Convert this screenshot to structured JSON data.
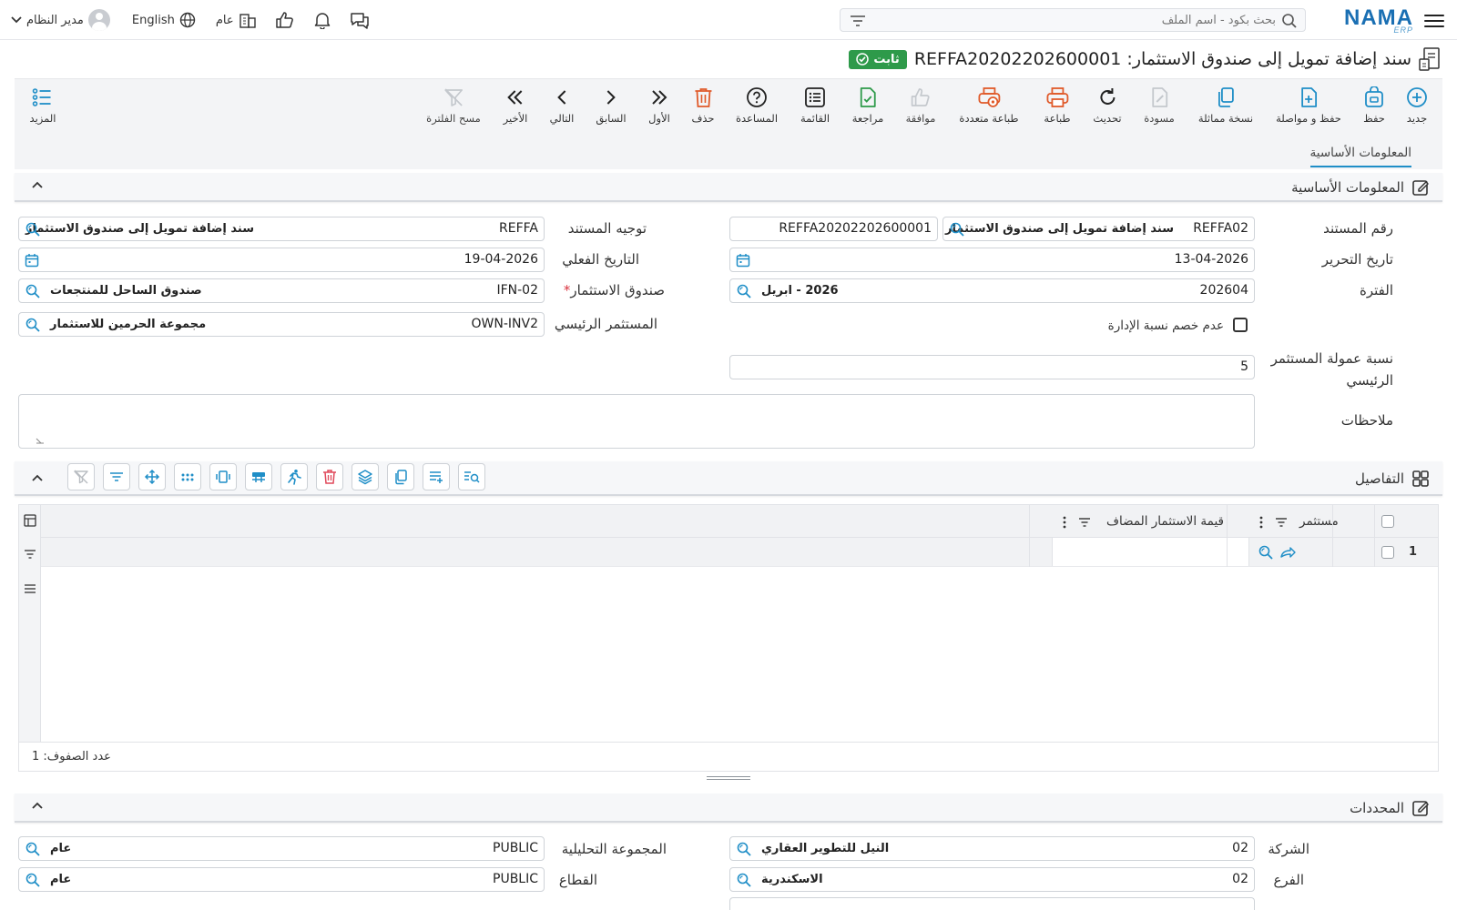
{
  "topbar": {
    "logo": "NAMA",
    "logo_sub": "ERP",
    "search_placeholder": "بحث بكود - اسم الملف",
    "user_name": "مدير النظام",
    "language": "English",
    "company_scope": "عام"
  },
  "title": {
    "text": "سند إضافة تمويل إلى صندوق الاستثمار: REFFA20202202600001",
    "status": "ثابت"
  },
  "toolbar": {
    "new": "جديد",
    "save": "حفظ",
    "save_continue": "حفظ و مواصلة",
    "duplicate": "نسخة مماثلة",
    "draft": "مسودة",
    "refresh": "تحديث",
    "print": "طباعة",
    "multi_print": "طباعة متعددة",
    "approve": "موافقة",
    "review": "مراجعة",
    "list": "القائمة",
    "help": "المساعدة",
    "delete": "حذف",
    "first": "الأول",
    "previous": "السابق",
    "next": "التالي",
    "last": "الأخير",
    "clear_filter": "مسح الفلترة",
    "more": "المزيد"
  },
  "tabs": {
    "basic_info": "المعلومات الأساسية"
  },
  "basic": {
    "section_title": "المعلومات الأساسية",
    "doc_number_label": "رقم المستند",
    "doc_type_code": "REFFA02",
    "doc_type_name": "سند إضافة تمويل إلى صندوق الاستثمار",
    "doc_number": "REFFA20202202600001",
    "direction_label": "توجيه المستند",
    "direction_code": "REFFA",
    "direction_name": "سند إضافة تمويل إلى صندوق الاستثمار",
    "issue_date_label": "تاريخ التحرير",
    "issue_date": "13-04-2026",
    "actual_date_label": "التاريخ الفعلي",
    "actual_date": "19-04-2026",
    "period_label": "الفترة",
    "period_code": "202604",
    "period_name": "2026 - ابريل",
    "fund_label": "صندوق الاستثمار",
    "fund_code": "IFN-02",
    "fund_name": "صندوق الساحل للمنتجعات",
    "no_mgmt_discount_label": "عدم خصم نسبة الإدارة",
    "main_investor_label": "المستثمر الرئيسي",
    "main_investor_code": "OWN-INV2",
    "main_investor_name": "مجموعة الحرمين للاستثمار",
    "commission_label_1": "نسبة عمولة المستثمر",
    "commission_label_2": "الرئيسي",
    "commission_value": "5",
    "notes_label": "ملاحظات"
  },
  "details": {
    "section_title": "التفاصيل",
    "columns": {
      "investor": "مستثمر",
      "added_value": "قيمة الاستثمار المضاف"
    },
    "rows": [
      {
        "index": "1"
      }
    ],
    "row_count": "عدد الصفوف: 1"
  },
  "dimensions": {
    "section_title": "المحددات",
    "company_label": "الشركة",
    "company_code": "02",
    "company_name": "النيل للتطوير العقاري",
    "analytic_label": "المجموعة التحليلية",
    "analytic_code": "PUBLIC",
    "analytic_name": "عام",
    "branch_label": "الفرع",
    "branch_code": "02",
    "branch_name": "الاسكندرية",
    "sector_label": "القطاع",
    "sector_code": "PUBLIC",
    "sector_name": "عام"
  },
  "colors": {
    "accent": "#1f8ec7",
    "status_green": "#2e9a4a",
    "danger": "#e05a2a",
    "delete_red": "#d9333f"
  }
}
